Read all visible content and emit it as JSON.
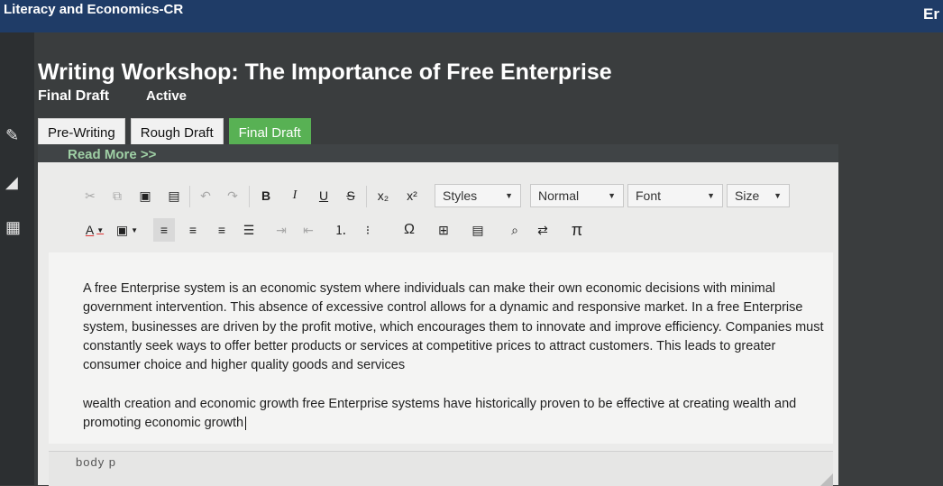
{
  "app": {
    "title": "Literacy and Economics-CR",
    "user_initial": "Er"
  },
  "page": {
    "title": "Writing Workshop: The Importance of Free Enterprise",
    "section": "Final Draft",
    "status": "Active"
  },
  "tabs": [
    {
      "label": "Pre-Writing",
      "active": false
    },
    {
      "label": "Rough Draft",
      "active": false
    },
    {
      "label": "Final Draft",
      "active": true
    }
  ],
  "read_more": "Read More >>",
  "toolbar": {
    "bold": "B",
    "italic": "I",
    "underline": "U",
    "strike": "S",
    "subscript": "x₂",
    "superscript": "x²",
    "styles": "Styles",
    "format": "Normal",
    "font": "Font",
    "size": "Size",
    "text_color": "A",
    "omega": "Ω",
    "pi": "π"
  },
  "editor": {
    "paragraphs": [
      "A free Enterprise system is an economic system where individuals can make their own economic decisions with minimal government intervention. This absence of excessive control allows for a dynamic and responsive market. In a free Enterprise system, businesses are driven by the profit  motive, which encourages them to innovate and improve efficiency. Companies must constantly seek ways to offer better products or services at competitive prices to attract customers. This leads to greater consumer choice and higher quality goods and services",
      "wealth creation and economic growth free Enterprise systems have historically proven to be effective at creating wealth and promoting economic growth"
    ],
    "element_path": "body   p"
  },
  "colors": {
    "header": "#1f3c67",
    "accent_green": "#58b154",
    "background": "#3a3d3e"
  }
}
